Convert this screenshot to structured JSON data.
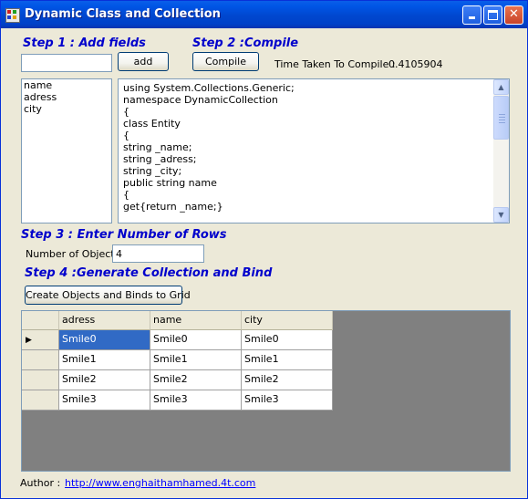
{
  "window": {
    "title": "Dynamic Class and Collection"
  },
  "step1": {
    "heading": "Step 1 : Add fields",
    "field_value": "",
    "add_label": "add",
    "fields": [
      "name",
      "adress",
      "city"
    ]
  },
  "step2": {
    "heading": "Step 2 :Compile",
    "compile_label": "Compile",
    "time_label": "Time Taken To Compile :",
    "time_value": "0.4105904",
    "code_lines": [
      "using System.Collections.Generic;",
      "namespace DynamicCollection",
      "{",
      "class Entity",
      "{",
      "string _name;",
      "string _adress;",
      "string _city;",
      "public string name",
      "{",
      "get{return _name;}"
    ]
  },
  "step3": {
    "heading": "Step 3 : Enter Number of Rows",
    "objects_label": "Number of Objects",
    "objects_value": "4"
  },
  "step4": {
    "heading": "Step 4 :Generate Collection and Bind",
    "button_label": "Create Objects and Binds to Grid"
  },
  "grid": {
    "columns": [
      "adress",
      "name",
      "city"
    ],
    "rows": [
      [
        "Smile0",
        "Smile0",
        "Smile0"
      ],
      [
        "Smile1",
        "Smile1",
        "Smile1"
      ],
      [
        "Smile2",
        "Smile2",
        "Smile2"
      ],
      [
        "Smile3",
        "Smile3",
        "Smile3"
      ]
    ],
    "current_row_marker": "▶"
  },
  "footer": {
    "author_label": "Author :",
    "author_link": "http://www.enghaithamhamed.4t.com"
  },
  "icons": {
    "minimize": "minimize-icon",
    "maximize": "maximize-icon",
    "close": "close-icon",
    "scroll_up": "chevron-up-icon",
    "scroll_down": "chevron-down-icon"
  }
}
